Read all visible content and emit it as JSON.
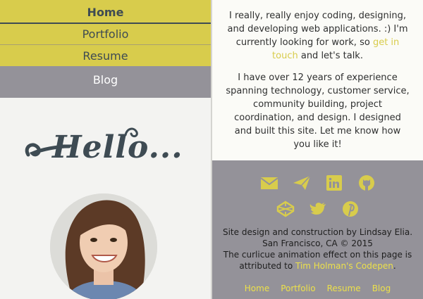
{
  "nav": {
    "home": "Home",
    "portfolio": "Portfolio",
    "resume": "Resume",
    "blog": "Blog"
  },
  "hero": {
    "greeting": "Hello..."
  },
  "intro": {
    "p1_before": "I really, really enjoy coding, designing, and developing web applications. :) I'm currently looking for work, so ",
    "p1_link": "get in touch",
    "p1_after": " and let's talk.",
    "p2": "I have over 12 years of experience spanning technology, customer service, community building, project coordination, and design. I designed and built this site. Let me know how you like it!"
  },
  "social_icons": [
    "envelope-icon",
    "paper-plane-icon",
    "linkedin-icon",
    "github-icon",
    "codepen-icon",
    "twitter-icon",
    "pinterest-icon"
  ],
  "credits": {
    "line1": "Site design and construction by Lindsay Elia.",
    "line2": "San Francisco, CA © 2015",
    "line3": "The curlicue animation effect on this page is",
    "line4_before": "attributed to ",
    "line4_link": "Tim Holman's Codepen",
    "line4_after": "."
  },
  "footer_nav": {
    "home": "Home",
    "portfolio": "Portfolio",
    "resume": "Resume",
    "blog": "Blog"
  },
  "colors": {
    "accent_yellow": "#d8cc4c",
    "link_yellow": "#ece04a",
    "gray": "#949299",
    "slate": "#3e4b53"
  }
}
